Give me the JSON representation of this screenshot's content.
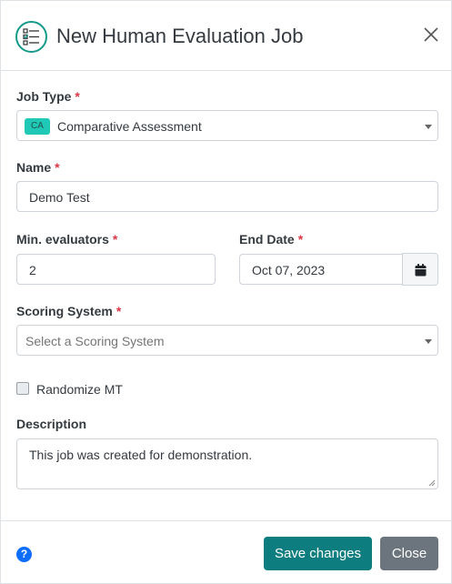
{
  "header": {
    "title": "New Human Evaluation Job",
    "icon": "checklist-icon",
    "accent_color": "#139a8b"
  },
  "form": {
    "job_type": {
      "label": "Job Type",
      "required_mark": "*",
      "badge": "CA",
      "value": "Comparative Assessment"
    },
    "name": {
      "label": "Name",
      "required_mark": "*",
      "value": "Demo Test"
    },
    "min_evaluators": {
      "label": "Min. evaluators",
      "required_mark": "*",
      "value": "2"
    },
    "end_date": {
      "label": "End Date",
      "required_mark": "*",
      "value": "Oct 07, 2023",
      "button_icon": "calendar-icon"
    },
    "scoring_system": {
      "label": "Scoring System",
      "required_mark": "*",
      "placeholder": "Select a Scoring System"
    },
    "randomize_mt": {
      "label": "Randomize MT",
      "checked": false
    },
    "description": {
      "label": "Description",
      "value": "This job was created for demonstration."
    }
  },
  "footer": {
    "help_icon": "question-circle-icon",
    "save_label": "Save changes",
    "close_label": "Close",
    "save_color": "#0e7d80",
    "close_color": "#6c757d"
  }
}
